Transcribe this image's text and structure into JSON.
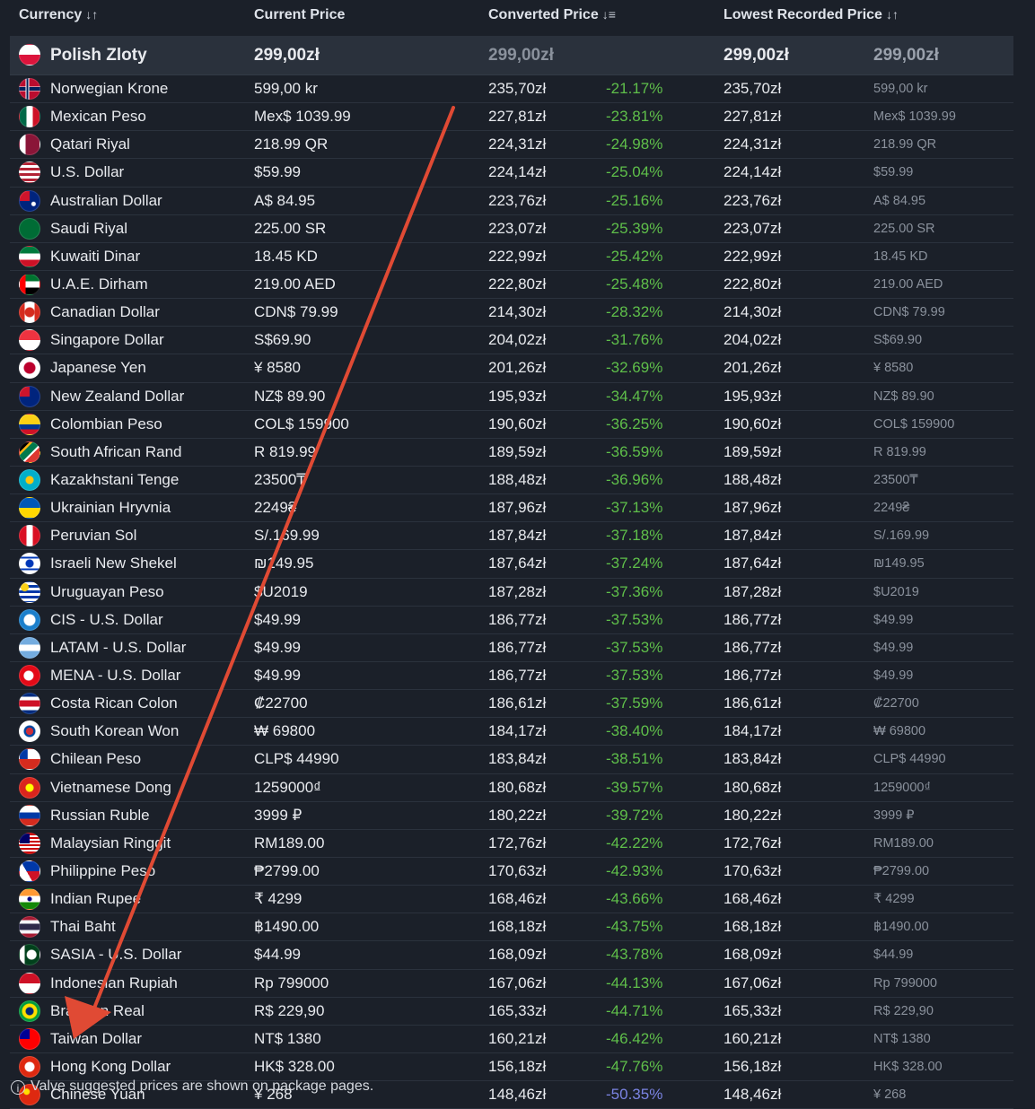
{
  "header": {
    "currency": "Currency",
    "current_price": "Current Price",
    "converted_price": "Converted Price",
    "lowest_recorded_price": "Lowest Recorded Price",
    "sort_icon": "↓↑",
    "sort_desc_icon": "↓≡"
  },
  "rows": [
    {
      "flag": "poland",
      "name": "Polish Zloty",
      "current": "299,00zł",
      "converted": "299,00zł",
      "pct": "",
      "lowest": "299,00zł",
      "lowest_cur": "299,00zł"
    },
    {
      "flag": "norway",
      "name": "Norwegian Krone",
      "current": "599,00 kr",
      "converted": "235,70zł",
      "pct": "-21.17%",
      "lowest": "235,70zł",
      "lowest_cur": "599,00 kr"
    },
    {
      "flag": "mexico",
      "name": "Mexican Peso",
      "current": "Mex$ 1039.99",
      "converted": "227,81zł",
      "pct": "-23.81%",
      "lowest": "227,81zł",
      "lowest_cur": "Mex$ 1039.99"
    },
    {
      "flag": "qatar",
      "name": "Qatari Riyal",
      "current": "218.99 QR",
      "converted": "224,31zł",
      "pct": "-24.98%",
      "lowest": "224,31zł",
      "lowest_cur": "218.99 QR"
    },
    {
      "flag": "usa",
      "name": "U.S. Dollar",
      "current": "$59.99",
      "converted": "224,14zł",
      "pct": "-25.04%",
      "lowest": "224,14zł",
      "lowest_cur": "$59.99"
    },
    {
      "flag": "australia",
      "name": "Australian Dollar",
      "current": "A$ 84.95",
      "converted": "223,76zł",
      "pct": "-25.16%",
      "lowest": "223,76zł",
      "lowest_cur": "A$ 84.95"
    },
    {
      "flag": "saudi",
      "name": "Saudi Riyal",
      "current": "225.00 SR",
      "converted": "223,07zł",
      "pct": "-25.39%",
      "lowest": "223,07zł",
      "lowest_cur": "225.00 SR"
    },
    {
      "flag": "kuwait",
      "name": "Kuwaiti Dinar",
      "current": "18.45 KD",
      "converted": "222,99zł",
      "pct": "-25.42%",
      "lowest": "222,99zł",
      "lowest_cur": "18.45 KD"
    },
    {
      "flag": "uae",
      "name": "U.A.E. Dirham",
      "current": "219.00 AED",
      "converted": "222,80zł",
      "pct": "-25.48%",
      "lowest": "222,80zł",
      "lowest_cur": "219.00 AED"
    },
    {
      "flag": "canada",
      "name": "Canadian Dollar",
      "current": "CDN$ 79.99",
      "converted": "214,30zł",
      "pct": "-28.32%",
      "lowest": "214,30zł",
      "lowest_cur": "CDN$ 79.99"
    },
    {
      "flag": "singapore",
      "name": "Singapore Dollar",
      "current": "S$69.90",
      "converted": "204,02zł",
      "pct": "-31.76%",
      "lowest": "204,02zł",
      "lowest_cur": "S$69.90"
    },
    {
      "flag": "japan",
      "name": "Japanese Yen",
      "current": "¥ 8580",
      "converted": "201,26zł",
      "pct": "-32.69%",
      "lowest": "201,26zł",
      "lowest_cur": "¥ 8580"
    },
    {
      "flag": "newzealand",
      "name": "New Zealand Dollar",
      "current": "NZ$ 89.90",
      "converted": "195,93zł",
      "pct": "-34.47%",
      "lowest": "195,93zł",
      "lowest_cur": "NZ$ 89.90"
    },
    {
      "flag": "colombia",
      "name": "Colombian Peso",
      "current": "COL$ 159900",
      "converted": "190,60zł",
      "pct": "-36.25%",
      "lowest": "190,60zł",
      "lowest_cur": "COL$ 159900"
    },
    {
      "flag": "southafrica",
      "name": "South African Rand",
      "current": "R 819.99",
      "converted": "189,59zł",
      "pct": "-36.59%",
      "lowest": "189,59zł",
      "lowest_cur": "R 819.99"
    },
    {
      "flag": "kazakhstan",
      "name": "Kazakhstani Tenge",
      "current": "23500₸",
      "converted": "188,48zł",
      "pct": "-36.96%",
      "lowest": "188,48zł",
      "lowest_cur": "23500₸"
    },
    {
      "flag": "ukraine",
      "name": "Ukrainian Hryvnia",
      "current": "2249₴",
      "converted": "187,96zł",
      "pct": "-37.13%",
      "lowest": "187,96zł",
      "lowest_cur": "2249₴"
    },
    {
      "flag": "peru",
      "name": "Peruvian Sol",
      "current": "S/.169.99",
      "converted": "187,84zł",
      "pct": "-37.18%",
      "lowest": "187,84zł",
      "lowest_cur": "S/.169.99"
    },
    {
      "flag": "israel",
      "name": "Israeli New Shekel",
      "current": "₪149.95",
      "converted": "187,64zł",
      "pct": "-37.24%",
      "lowest": "187,64zł",
      "lowest_cur": "₪149.95"
    },
    {
      "flag": "uruguay",
      "name": "Uruguayan Peso",
      "current": "$U2019",
      "converted": "187,28zł",
      "pct": "-37.36%",
      "lowest": "187,28zł",
      "lowest_cur": "$U2019"
    },
    {
      "flag": "cis",
      "name": "CIS - U.S. Dollar",
      "current": "$49.99",
      "converted": "186,77zł",
      "pct": "-37.53%",
      "lowest": "186,77zł",
      "lowest_cur": "$49.99"
    },
    {
      "flag": "argentina",
      "name": "LATAM - U.S. Dollar",
      "current": "$49.99",
      "converted": "186,77zł",
      "pct": "-37.53%",
      "lowest": "186,77zł",
      "lowest_cur": "$49.99"
    },
    {
      "flag": "turkey",
      "name": "MENA - U.S. Dollar",
      "current": "$49.99",
      "converted": "186,77zł",
      "pct": "-37.53%",
      "lowest": "186,77zł",
      "lowest_cur": "$49.99"
    },
    {
      "flag": "costarica",
      "name": "Costa Rican Colon",
      "current": "₡22700",
      "converted": "186,61zł",
      "pct": "-37.59%",
      "lowest": "186,61zł",
      "lowest_cur": "₡22700"
    },
    {
      "flag": "korea",
      "name": "South Korean Won",
      "current": "₩ 69800",
      "converted": "184,17zł",
      "pct": "-38.40%",
      "lowest": "184,17zł",
      "lowest_cur": "₩ 69800"
    },
    {
      "flag": "chile",
      "name": "Chilean Peso",
      "current": "CLP$ 44990",
      "converted": "183,84zł",
      "pct": "-38.51%",
      "lowest": "183,84zł",
      "lowest_cur": "CLP$ 44990"
    },
    {
      "flag": "vietnam",
      "name": "Vietnamese Dong",
      "current": "1259000₫",
      "converted": "180,68zł",
      "pct": "-39.57%",
      "lowest": "180,68zł",
      "lowest_cur": "1259000₫"
    },
    {
      "flag": "russia",
      "name": "Russian Ruble",
      "current": "3999 ₽",
      "converted": "180,22zł",
      "pct": "-39.72%",
      "lowest": "180,22zł",
      "lowest_cur": "3999 ₽"
    },
    {
      "flag": "malaysia",
      "name": "Malaysian Ringgit",
      "current": "RM189.00",
      "converted": "172,76zł",
      "pct": "-42.22%",
      "lowest": "172,76zł",
      "lowest_cur": "RM189.00"
    },
    {
      "flag": "philippines",
      "name": "Philippine Peso",
      "current": "₱2799.00",
      "converted": "170,63zł",
      "pct": "-42.93%",
      "lowest": "170,63zł",
      "lowest_cur": "₱2799.00"
    },
    {
      "flag": "india",
      "name": "Indian Rupee",
      "current": "₹ 4299",
      "converted": "168,46zł",
      "pct": "-43.66%",
      "lowest": "168,46zł",
      "lowest_cur": "₹ 4299"
    },
    {
      "flag": "thailand",
      "name": "Thai Baht",
      "current": "฿1490.00",
      "converted": "168,18zł",
      "pct": "-43.75%",
      "lowest": "168,18zł",
      "lowest_cur": "฿1490.00"
    },
    {
      "flag": "pakistan",
      "name": "SASIA - U.S. Dollar",
      "current": "$44.99",
      "converted": "168,09zł",
      "pct": "-43.78%",
      "lowest": "168,09zł",
      "lowest_cur": "$44.99"
    },
    {
      "flag": "indonesia",
      "name": "Indonesian Rupiah",
      "current": "Rp 799000",
      "converted": "167,06zł",
      "pct": "-44.13%",
      "lowest": "167,06zł",
      "lowest_cur": "Rp 799000"
    },
    {
      "flag": "brazil",
      "name": "Brazilian Real",
      "current": "R$ 229,90",
      "converted": "165,33zł",
      "pct": "-44.71%",
      "lowest": "165,33zł",
      "lowest_cur": "R$ 229,90"
    },
    {
      "flag": "taiwan",
      "name": "Taiwan Dollar",
      "current": "NT$ 1380",
      "converted": "160,21zł",
      "pct": "-46.42%",
      "lowest": "160,21zł",
      "lowest_cur": "NT$ 1380"
    },
    {
      "flag": "hongkong",
      "name": "Hong Kong Dollar",
      "current": "HK$ 328.00",
      "converted": "156,18zł",
      "pct": "-47.76%",
      "lowest": "156,18zł",
      "lowest_cur": "HK$ 328.00"
    },
    {
      "flag": "china",
      "name": "Chinese Yuan",
      "current": "¥ 268",
      "converted": "148,46zł",
      "pct": "-50.35%",
      "lowest": "148,46zł",
      "lowest_cur": "¥ 268"
    }
  ],
  "footer": {
    "info_icon": "i",
    "note": "Valve suggested prices are shown on package pages."
  },
  "colors": {
    "background": "#1b2029",
    "highlight_row": "#2a313c",
    "negative_pct": "#5fbf4a",
    "best_pct": "#7b84e3",
    "annotation_arrow": "#e04a34"
  }
}
